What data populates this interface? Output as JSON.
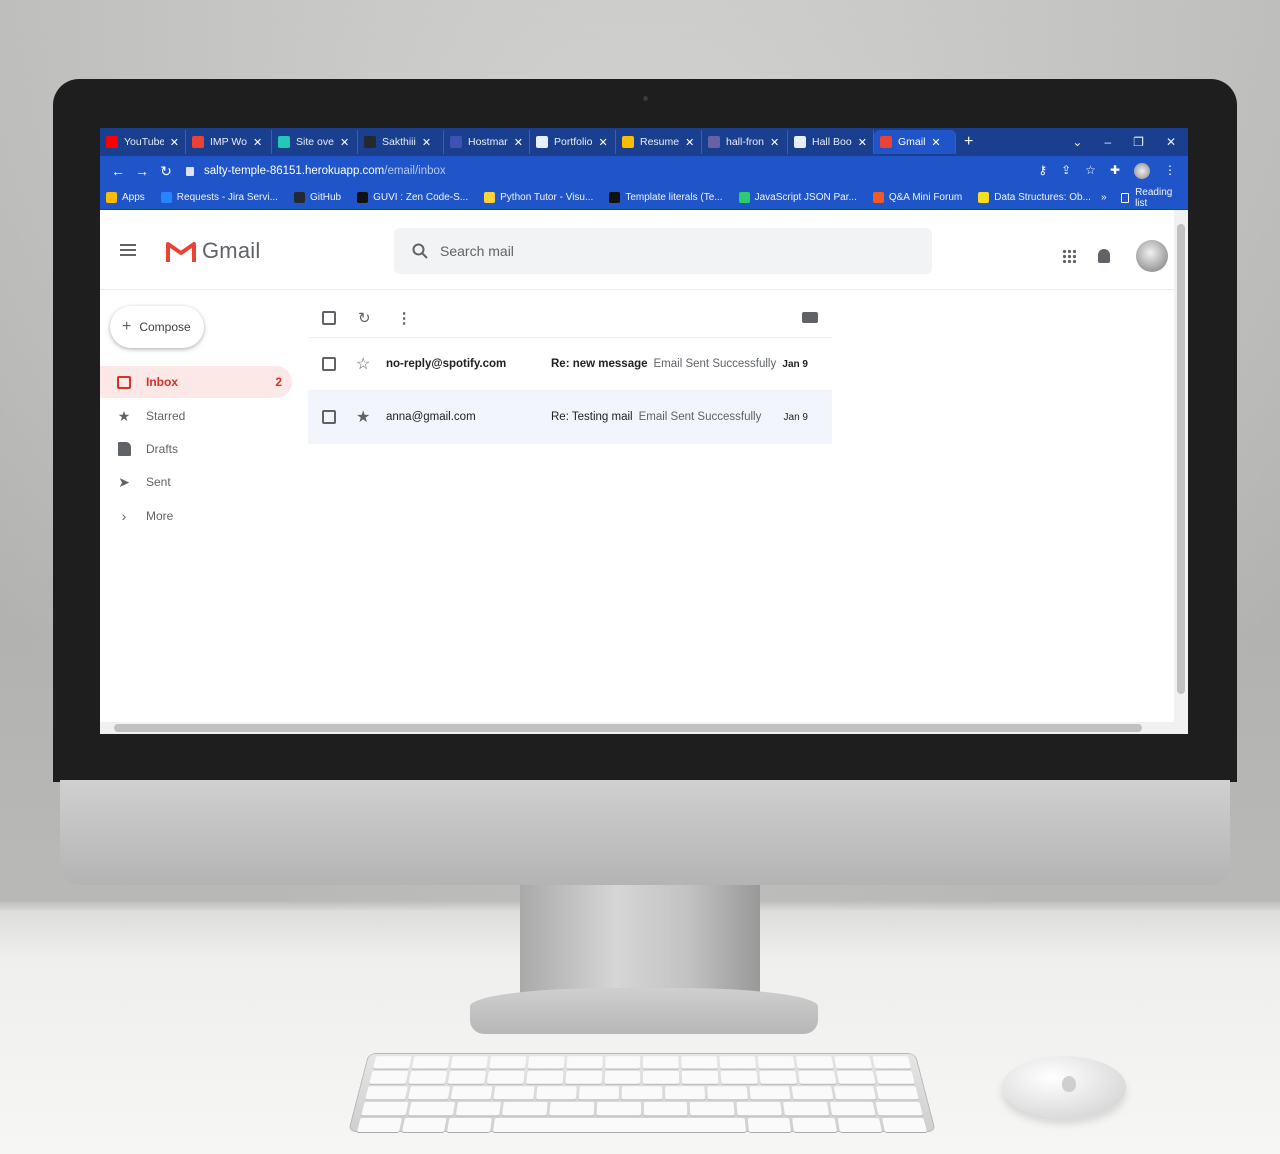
{
  "browser": {
    "tabs": [
      {
        "label": "YouTube",
        "favicon": "youtube-icon",
        "color": "#ff0000"
      },
      {
        "label": "IMP Wo",
        "favicon": "gmail-icon",
        "color": "#ea4335"
      },
      {
        "label": "Site ove",
        "favicon": "netlify-icon",
        "color": "#25c7b7"
      },
      {
        "label": "Sakthiii",
        "favicon": "github-icon",
        "color": "#24292e"
      },
      {
        "label": "Hostmar",
        "favicon": "hostman-icon",
        "color": "#3f51b5"
      },
      {
        "label": "Portfolio",
        "favicon": "globe-icon",
        "color": "#e8eefc"
      },
      {
        "label": "Resume",
        "favicon": "drive-icon",
        "color": "#fbbc04"
      },
      {
        "label": "hall-fron",
        "favicon": "heroku-icon",
        "color": "#6762a6"
      },
      {
        "label": "Hall Boo",
        "favicon": "globe-icon",
        "color": "#e8eefc"
      },
      {
        "label": "Gmail",
        "favicon": "gmail-icon",
        "color": "#ea4335",
        "active": true
      }
    ],
    "new_tab": "+",
    "window_controls": [
      "⌄",
      "–",
      "❐",
      "✕"
    ],
    "url": "salty-temple-86151.herokuapp.com/email/inbox",
    "url_domain": "salty-temple-86151.herokuapp.com",
    "url_path": "/email/inbox",
    "bookmarks": [
      {
        "label": "Apps",
        "color": "#fbbc04"
      },
      {
        "label": "Requests - Jira Servi...",
        "color": "#2684ff"
      },
      {
        "label": "GitHub",
        "color": "#24292e"
      },
      {
        "label": "GUVI : Zen Code-S...",
        "color": "#111111"
      },
      {
        "label": "Python Tutor - Visu...",
        "color": "#ffd43b"
      },
      {
        "label": "Template literals (Te...",
        "color": "#111111"
      },
      {
        "label": "JavaScript JSON Par...",
        "color": "#2ecc71"
      },
      {
        "label": "Q&A Mini Forum",
        "color": "#f15a24"
      },
      {
        "label": "Data Structures: Ob...",
        "color": "#f7df1e"
      }
    ],
    "bookmarks_overflow": "»",
    "reading_list": "Reading list"
  },
  "gmail": {
    "logo_text": "Gmail",
    "search_placeholder": "Search mail",
    "compose_label": "Compose",
    "nav": [
      {
        "label": "Inbox",
        "count": "2",
        "icon": "inbox-icon",
        "active": true
      },
      {
        "label": "Starred",
        "count": "",
        "icon": "star-icon"
      },
      {
        "label": "Drafts",
        "count": "",
        "icon": "draft-icon"
      },
      {
        "label": "Sent",
        "count": "",
        "icon": "send-icon"
      },
      {
        "label": "More",
        "count": "",
        "icon": "chevron-right-icon"
      }
    ],
    "emails": [
      {
        "from": "no-reply@spotify.com",
        "subject": "Re: new message",
        "snippet": "Email Sent Successfully",
        "date": "Jan 9",
        "unread": true,
        "starred": false
      },
      {
        "from": "anna@gmail.com",
        "subject": "Re: Testing mail",
        "snippet": "Email Sent Successfully",
        "date": "Jan 9",
        "unread": false,
        "starred": true
      }
    ],
    "accent": "#d93025"
  }
}
